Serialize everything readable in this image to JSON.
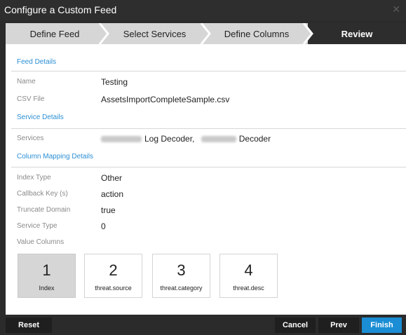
{
  "dialog": {
    "title": "Configure a Custom Feed",
    "close_glyph": "✕"
  },
  "wizard": {
    "steps": [
      {
        "label": "Define Feed"
      },
      {
        "label": "Select Services"
      },
      {
        "label": "Define Columns"
      },
      {
        "label": "Review",
        "active": true
      }
    ]
  },
  "feed_details": {
    "heading": "Feed Details",
    "name_label": "Name",
    "name_value": "Testing",
    "csv_label": "CSV File",
    "csv_value": "AssetsImportCompleteSample.csv"
  },
  "service_details": {
    "heading": "Service Details",
    "services_label": "Services",
    "service1_suffix": "Log Decoder,",
    "service2_suffix": "Decoder"
  },
  "column_mapping": {
    "heading": "Column Mapping Details",
    "index_type_label": "Index Type",
    "index_type_value": "Other",
    "callback_label": "Callback Key (s)",
    "callback_value": "action",
    "truncate_label": "Truncate Domain",
    "truncate_value": "true",
    "service_type_label": "Service Type",
    "service_type_value": "0",
    "value_columns_label": "Value Columns",
    "columns": [
      {
        "number": "1",
        "name": "Index",
        "selected": true
      },
      {
        "number": "2",
        "name": "threat.source"
      },
      {
        "number": "3",
        "name": "threat.category"
      },
      {
        "number": "4",
        "name": "threat.desc"
      }
    ]
  },
  "footer": {
    "reset": "Reset",
    "cancel": "Cancel",
    "prev": "Prev",
    "finish": "Finish"
  },
  "colors": {
    "accent": "#1a8dd4",
    "section_heading": "#2b8fd4",
    "titlebar": "#2e2e2e",
    "wizard_inactive": "#d6d6d6",
    "wizard_active": "#2d2d2d"
  }
}
